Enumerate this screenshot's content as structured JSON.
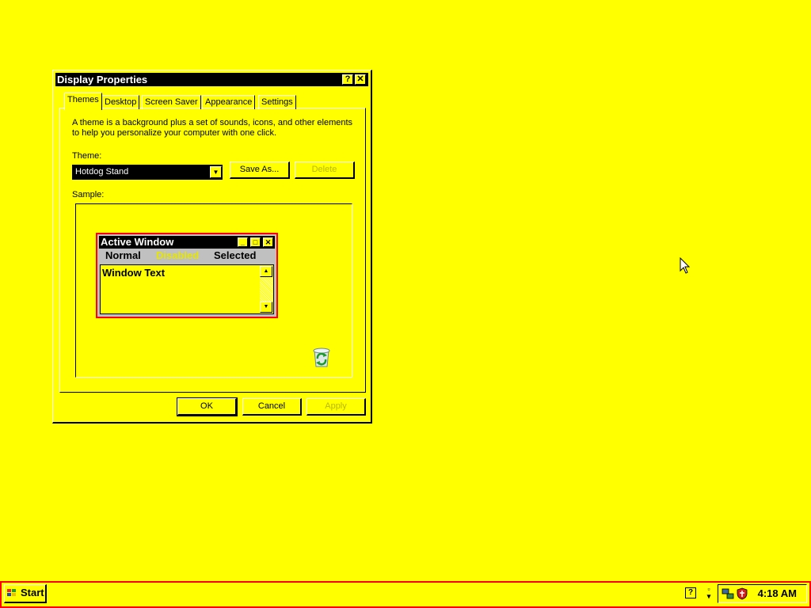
{
  "dialog": {
    "title": "Display Properties",
    "help_glyph": "?",
    "close_glyph": "✕",
    "tabs": [
      {
        "label": "Themes",
        "active": true
      },
      {
        "label": "Desktop"
      },
      {
        "label": "Screen Saver"
      },
      {
        "label": "Appearance"
      },
      {
        "label": "Settings"
      }
    ],
    "description": "A theme is a background plus a set of sounds, icons, and other elements to help you personalize your computer with one click.",
    "theme_label": "Theme:",
    "theme_value": "Hotdog Stand",
    "save_as_label": "Save As...",
    "delete_label": "Delete",
    "sample_label": "Sample:",
    "sample": {
      "title": "Active Window",
      "menu_normal": "Normal",
      "menu_disabled": "Disabled",
      "menu_selected": "Selected",
      "window_text": "Window Text"
    },
    "ok_label": "OK",
    "cancel_label": "Cancel",
    "apply_label": "Apply"
  },
  "taskbar": {
    "start_label": "Start",
    "help_glyph": "?",
    "clock": "4:18 AM"
  },
  "colors": {
    "desktop": "#ffff00",
    "titlebar": "#000000",
    "accent_border": "#ff0000"
  },
  "icons": [
    "help-icon",
    "close-icon",
    "dropdown-arrow-icon",
    "minimize-icon",
    "maximize-icon",
    "recycle-bin-icon",
    "mouse-cursor-icon",
    "windows-flag-icon",
    "network-icon",
    "security-shield-icon"
  ]
}
